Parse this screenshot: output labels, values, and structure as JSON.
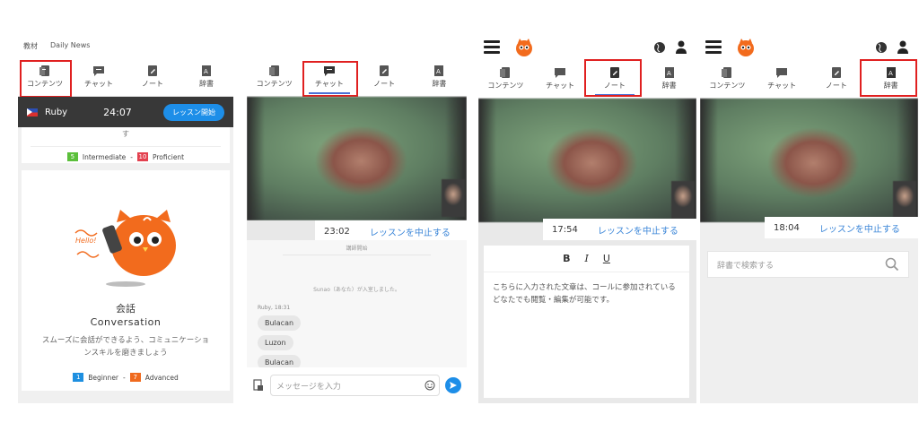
{
  "tabs": [
    {
      "label": "コンテンツ",
      "icon": "content-icon"
    },
    {
      "label": "チャット",
      "icon": "chat-icon"
    },
    {
      "label": "ノート",
      "icon": "note-icon"
    },
    {
      "label": "辞書",
      "icon": "dictionary-icon"
    }
  ],
  "panel1": {
    "header_links": [
      "教材",
      "Daily News"
    ],
    "tutor_name": "Ruby",
    "timer": "24:07",
    "start_button": "レッスン開始",
    "truncated_text": "す",
    "levels_top": {
      "low_num": "5",
      "low_label": "Intermediate",
      "sep": "-",
      "high_num": "10",
      "high_label": "Proficient"
    },
    "mascot_hello": "Hello!",
    "course_title_jp": "会話",
    "course_title_en": "Conversation",
    "course_desc": "スムーズに会話ができるよう、コミュニケーションスキルを磨きましょう",
    "levels_bottom": {
      "low_num": "1",
      "low_label": "Beginner",
      "sep": "-",
      "high_num": "7",
      "high_label": "Advanced"
    }
  },
  "panel2": {
    "timer": "23:02",
    "stop_label": "レッスンを中止する",
    "sys_start": "講師開始",
    "sys_join": "Sunao（あなた）が入室しました。",
    "msg_meta": "Ruby, 18:31",
    "messages": [
      "Bulacan",
      "Luzon",
      "Bulacan"
    ],
    "input_placeholder": "メッセージを入力"
  },
  "panel3": {
    "timer": "17:54",
    "stop_label": "レッスンを中止する",
    "fmt_bold": "B",
    "fmt_italic": "I",
    "fmt_underline": "U",
    "note_text": "こちらに入力された文章は、コールに参加されているどなたでも閲覧・編集が可能です。"
  },
  "panel4": {
    "timer": "18:04",
    "stop_label": "レッスンを中止する",
    "search_placeholder": "辞書で検索する"
  },
  "colors": {
    "highlight": "#e02020",
    "accent_blue": "#1d8ee8",
    "brand_orange": "#f26b1d"
  }
}
